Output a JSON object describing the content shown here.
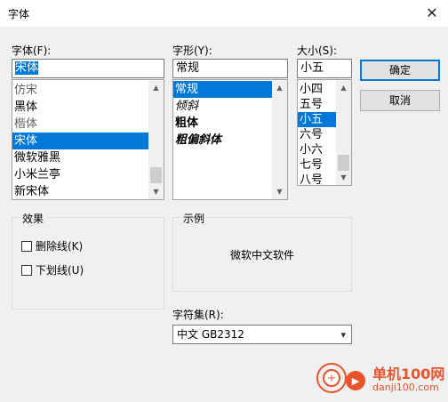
{
  "window": {
    "title": "字体",
    "close_glyph": "✕"
  },
  "font": {
    "label": "字体(F):",
    "value": "宋体",
    "items": [
      "仿宋",
      "黑体",
      "楷体",
      "宋体",
      "微软雅黑",
      "小米兰亭",
      "新宋体"
    ],
    "selected_index": 3
  },
  "style": {
    "label": "字形(Y):",
    "value": "常规",
    "items": [
      "常规",
      "倾斜",
      "粗体",
      "粗偏斜体"
    ],
    "selected_index": 0
  },
  "size": {
    "label": "大小(S):",
    "value": "小五",
    "items": [
      "小四",
      "五号",
      "小五",
      "六号",
      "小六",
      "七号",
      "八号"
    ],
    "selected_index": 2
  },
  "buttons": {
    "ok": "确定",
    "cancel": "取消"
  },
  "effects": {
    "title": "效果",
    "strikeout": "删除线(K)",
    "underline": "下划线(U)"
  },
  "sample": {
    "title": "示例",
    "text": "微软中文软件"
  },
  "script": {
    "label": "字符集(R):",
    "value": "中文 GB2312"
  },
  "watermark": {
    "name": "单机100网",
    "url": "danji100.com"
  },
  "colors": {
    "accent": "#0078d7",
    "wm_orange": "#e8542b"
  }
}
